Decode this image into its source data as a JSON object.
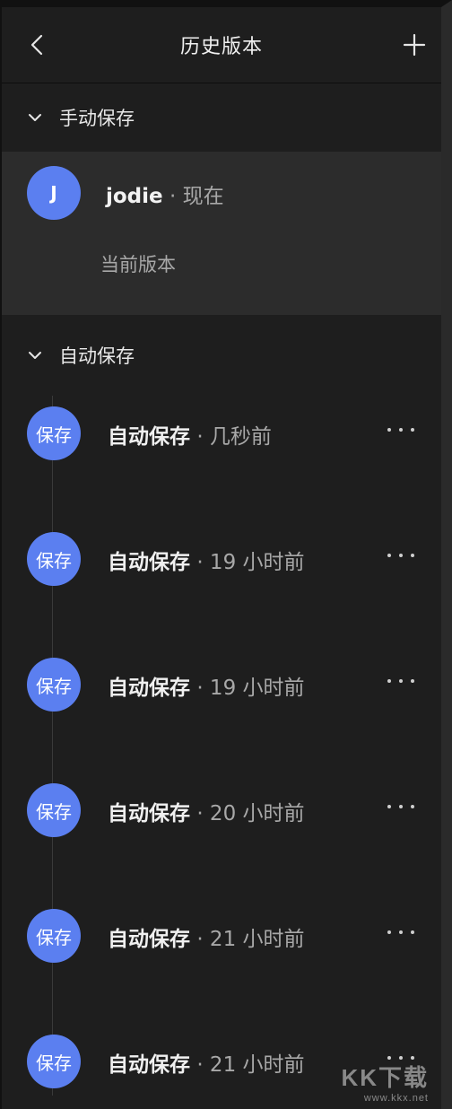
{
  "header": {
    "title": "历史版本"
  },
  "manual": {
    "section_label": "手动保存",
    "avatar_initial": "J",
    "user": "jodie",
    "time": "· 现在",
    "current_label": "当前版本"
  },
  "auto": {
    "section_label": "自动保存",
    "badge_text": "保存",
    "items": [
      {
        "title": "自动保存",
        "time": "· 几秒前"
      },
      {
        "title": "自动保存",
        "time": "· 19 小时前"
      },
      {
        "title": "自动保存",
        "time": "· 19 小时前"
      },
      {
        "title": "自动保存",
        "time": "· 20 小时前"
      },
      {
        "title": "自动保存",
        "time": "· 21 小时前"
      },
      {
        "title": "自动保存",
        "time": "· 21 小时前"
      }
    ]
  },
  "watermark": {
    "brand": "KK下载",
    "url": "www.kkx.net"
  },
  "icons": {
    "back": "chevron-left-icon",
    "add": "plus-icon",
    "collapse": "chevron-down-icon",
    "more": "more-horizontal-icon"
  },
  "colors": {
    "accent": "#5b7ff0",
    "background": "#1e1e1e",
    "selected": "#2c2c2c"
  }
}
